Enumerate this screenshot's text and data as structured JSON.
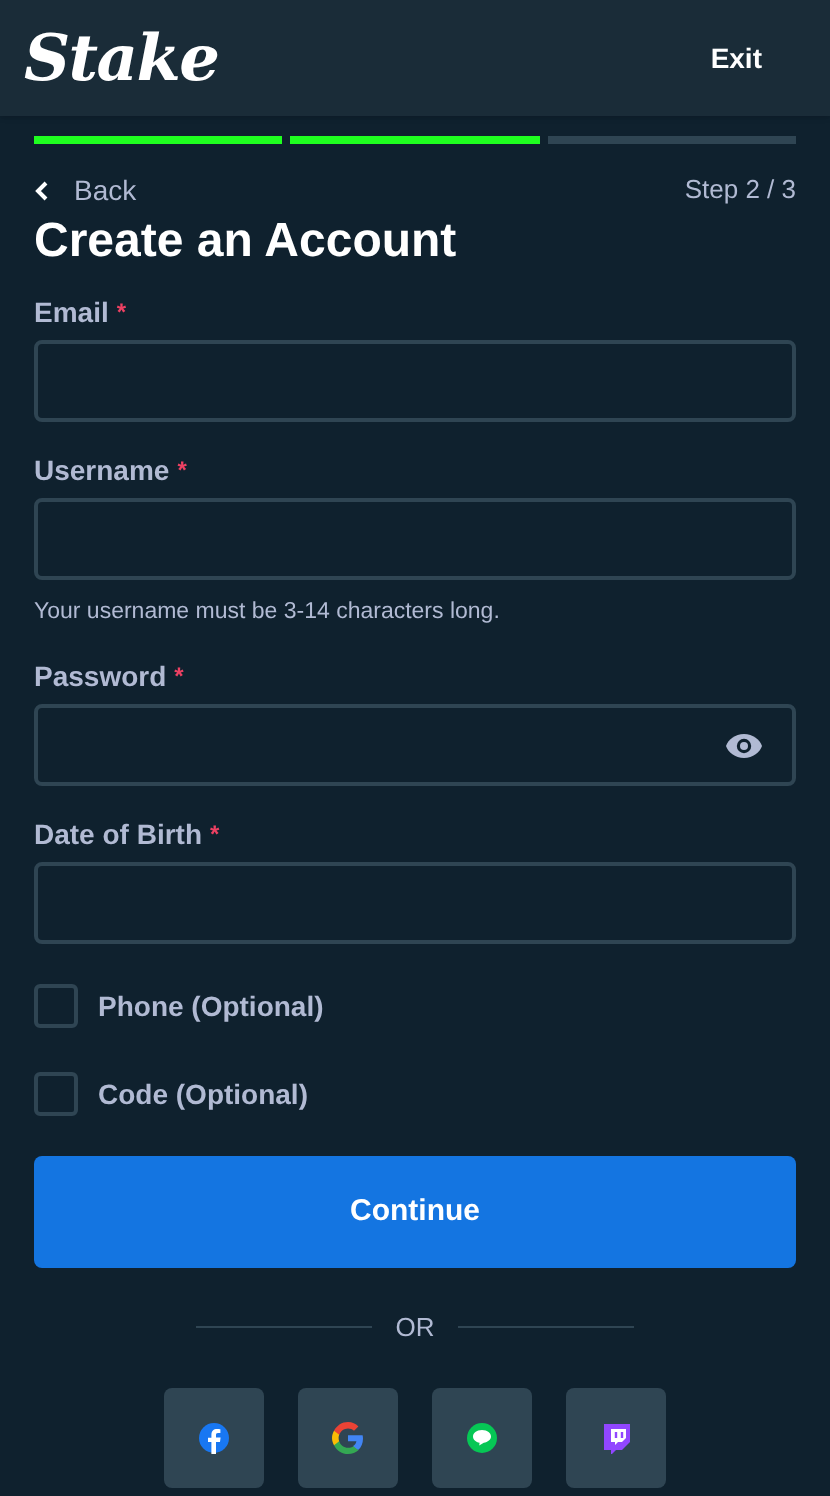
{
  "header": {
    "logo": "Stake",
    "exit": "Exit"
  },
  "progress": [
    {
      "complete": true
    },
    {
      "complete": true
    },
    {
      "complete": false
    }
  ],
  "nav": {
    "back": "Back",
    "step": "Step 2 / 3"
  },
  "title": "Create an Account",
  "fields": [
    {
      "label": "Email",
      "required": "*",
      "kind": "text"
    },
    {
      "label": "Username",
      "required": "*",
      "kind": "text",
      "hint": "Your username must be 3-14 characters long."
    },
    {
      "label": "Password",
      "required": "*",
      "kind": "password"
    },
    {
      "label": "Date of Birth",
      "required": "*",
      "kind": "text"
    }
  ],
  "options": [
    {
      "label": "Phone (Optional)",
      "checked": false
    },
    {
      "label": "Code (Optional)",
      "checked": false
    }
  ],
  "continue": "Continue",
  "divider": "OR"
}
